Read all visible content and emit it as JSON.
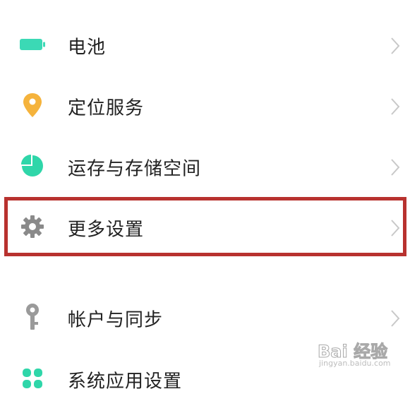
{
  "settings": {
    "items": [
      {
        "label": "电池",
        "icon": "battery-icon",
        "color": "#3bd9b5"
      },
      {
        "label": "定位服务",
        "icon": "location-pin-icon",
        "color": "#f5b33c"
      },
      {
        "label": "运存与存储空间",
        "icon": "storage-pie-icon",
        "color": "#2fd6a9"
      },
      {
        "label": "更多设置",
        "icon": "gear-icon",
        "color": "#8a8a8a"
      },
      {
        "label": "帐户与同步",
        "icon": "key-icon",
        "color": "#9a9a9a"
      },
      {
        "label": "系统应用设置",
        "icon": "apps-icon",
        "color": "#2fd6a9"
      }
    ]
  },
  "highlight": {
    "color": "#b8322f"
  },
  "watermark": {
    "main": "Bai 经验",
    "sub": "jingyan.baidu.com"
  }
}
